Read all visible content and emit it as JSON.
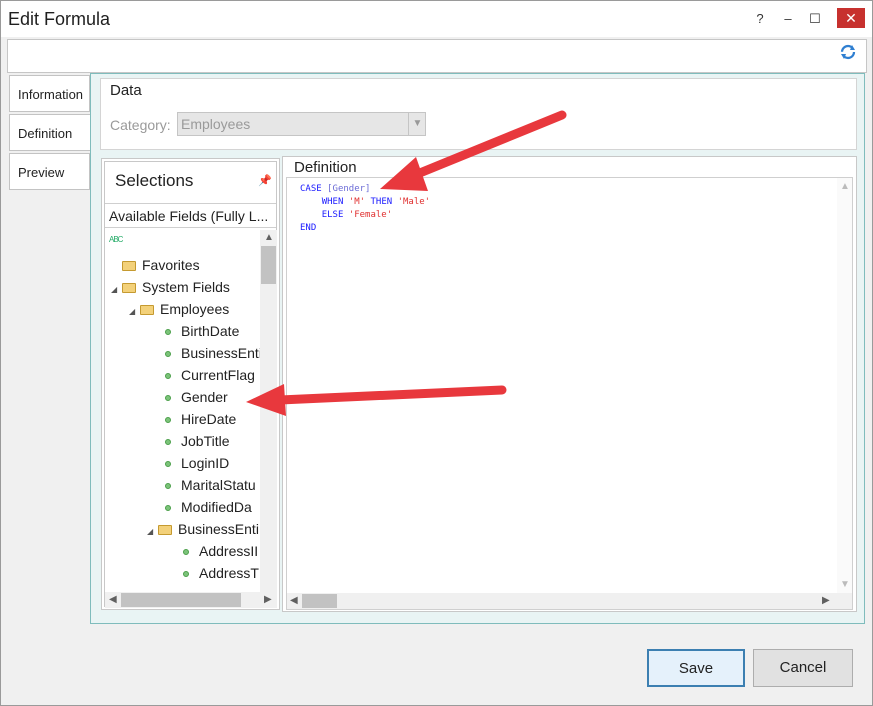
{
  "window": {
    "title": "Edit Formula",
    "help": "?",
    "minimize": "–",
    "maximize": "☐",
    "close": "✕"
  },
  "tabs": [
    {
      "label": "Information"
    },
    {
      "label": "Definition"
    },
    {
      "label": "Preview"
    }
  ],
  "data_group": {
    "label": "Data",
    "category_label": "Category:",
    "category_value": "Employees"
  },
  "selections": {
    "title": "Selections",
    "available_label": "Available Fields (Fully L...",
    "tree": [
      {
        "label": "Favorites"
      },
      {
        "label": "System Fields"
      },
      {
        "label": "Employees"
      },
      {
        "label": "BirthDate"
      },
      {
        "label": "BusinessEnti"
      },
      {
        "label": "CurrentFlag"
      },
      {
        "label": "Gender"
      },
      {
        "label": "HireDate"
      },
      {
        "label": "JobTitle"
      },
      {
        "label": "LoginID"
      },
      {
        "label": "MaritalStatu"
      },
      {
        "label": "ModifiedDa"
      },
      {
        "label": "BusinessEnti"
      },
      {
        "label": "AddressII"
      },
      {
        "label": "AddressT"
      }
    ]
  },
  "definition": {
    "label": "Definition",
    "code": {
      "l1_kw": "CASE",
      "l1_col": "[Gender]",
      "l2_when": "WHEN",
      "l2_m": "'M'",
      "l2_then": "THEN",
      "l2_male": "'Male'",
      "l3_else": "ELSE",
      "l3_female": "'Female'",
      "l4_end": "END"
    }
  },
  "buttons": {
    "save": "Save",
    "cancel": "Cancel"
  },
  "colors": {
    "accent": "#7fbcbc",
    "close": "#c7312e",
    "arrow": "#e8383d",
    "keyword": "#1a1aff",
    "string": "#e03030"
  }
}
